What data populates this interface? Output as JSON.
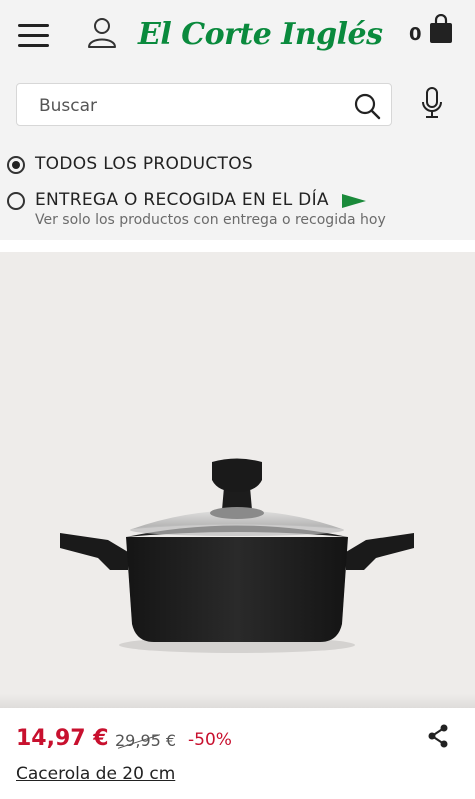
{
  "header": {
    "logo_text": "El Corte Inglés",
    "cart_count": "0",
    "brand_color": "#0a8a3d",
    "icons": [
      "menu-icon",
      "user-icon",
      "shopping-bag-icon"
    ]
  },
  "search": {
    "placeholder": "Buscar",
    "icons": [
      "search-icon",
      "microphone-icon"
    ]
  },
  "filters": {
    "all_products": {
      "label": "TODOS LOS PRODUCTOS",
      "selected": true
    },
    "same_day": {
      "label": "ENTREGA O RECOGIDA EN EL DÍA",
      "subtitle": "Ver solo los productos con entrega o recogida hoy",
      "selected": false,
      "flag_color": "#1a8a3a"
    }
  },
  "product": {
    "image_icon": "cooking-pot-image",
    "price": "14,97 €",
    "old_price": "29,95 €",
    "discount": "-50%",
    "title": "Cacerola de 20 cm",
    "price_color": "#c8102e"
  }
}
